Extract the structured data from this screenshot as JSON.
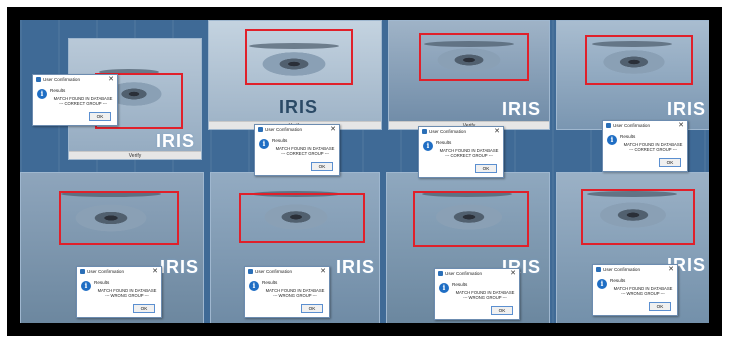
{
  "app": {
    "logo_text": "IRIS",
    "verify_label": "Verify"
  },
  "dialog": {
    "title": "User Confirmation",
    "heading": "Results",
    "ok_label": "OK",
    "close_glyph": "✕",
    "info_glyph": "i"
  },
  "tiles": [
    {
      "id": "r1c1",
      "result_line1": "MATCH FOUND IN DATABASE",
      "result_line2": "--- CORRECT GROUP ---"
    },
    {
      "id": "r1c2",
      "result_line1": "MATCH FOUND IN DATABASE",
      "result_line2": "--- CORRECT GROUP ---"
    },
    {
      "id": "r1c3",
      "result_line1": "MATCH FOUND IN DATABASE",
      "result_line2": "--- CORRECT GROUP ---"
    },
    {
      "id": "r1c4",
      "result_line1": "MATCH FOUND IN DATABASE",
      "result_line2": "--- CORRECT GROUP ---"
    },
    {
      "id": "r2c1",
      "result_line1": "MATCH FOUND IN DATABASE",
      "result_line2": "--- WRONG GROUP ---"
    },
    {
      "id": "r2c2",
      "result_line1": "MATCH FOUND IN DATABASE",
      "result_line2": "--- WRONG GROUP ---"
    },
    {
      "id": "r2c3",
      "result_line1": "MATCH FOUND IN DATABASE",
      "result_line2": "--- WRONG GROUP ---"
    },
    {
      "id": "r2c4",
      "result_line1": "MATCH FOUND IN DATABASE",
      "result_line2": "--- WRONG GROUP ---"
    }
  ],
  "colors": {
    "roi": "#e0202a",
    "frame": "#000000",
    "mosaic": "#3f6a96"
  }
}
